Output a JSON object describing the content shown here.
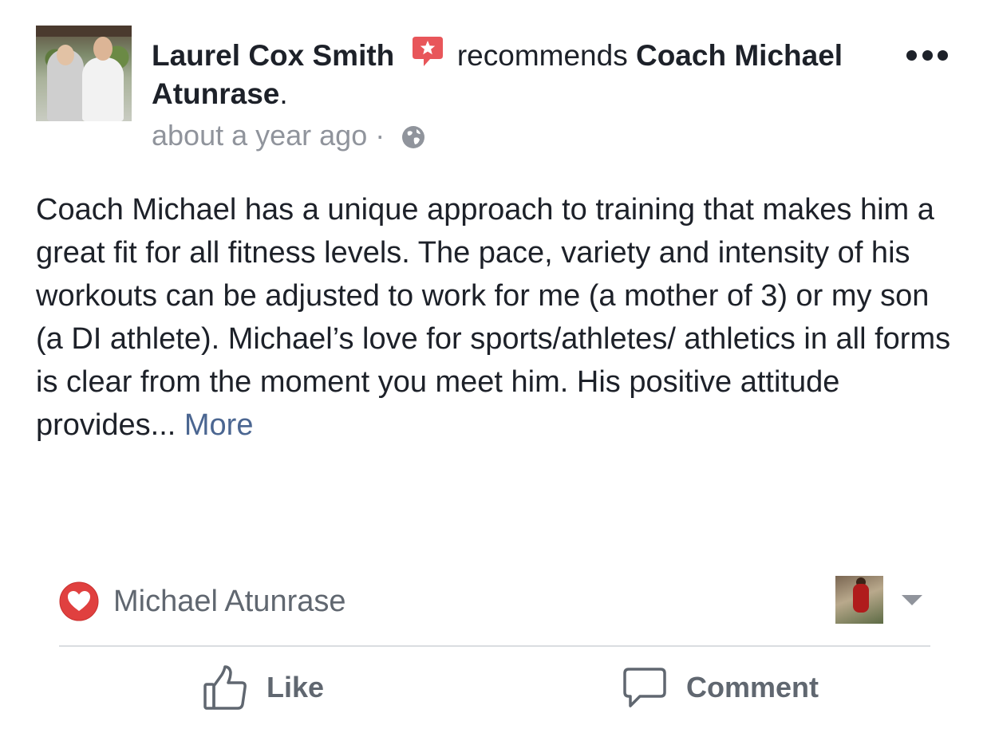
{
  "post": {
    "author": "Laurel Cox Smith",
    "verb": "recommends",
    "target": "Coach Michael Atunrase",
    "target_suffix": ".",
    "timestamp": "about a year ago",
    "separator": "·",
    "privacy_icon": "globe-icon",
    "badge_icon": "recommendation-star-icon",
    "menu_icon": "more-options-icon",
    "body": "Coach Michael has a unique approach to training that makes him a great fit for all fitness levels. The pace, variety and intensity of his workouts can be adjusted to work for me (a mother of 3) or my son (a DI athlete). Michael’s love for sports/athletes/ athletics in all forms is clear from the moment you meet him. His positive attitude provides...",
    "more_label": "More"
  },
  "reaction": {
    "icon": "love-reaction-icon",
    "name": "Michael Atunrase"
  },
  "actions": {
    "like_label": "Like",
    "comment_label": "Comment"
  },
  "colors": {
    "text": "#1d2129",
    "secondary": "#90949c",
    "link": "#4b6691",
    "action": "#606770",
    "heart": "#e0403f",
    "badge": "#e8565a"
  }
}
